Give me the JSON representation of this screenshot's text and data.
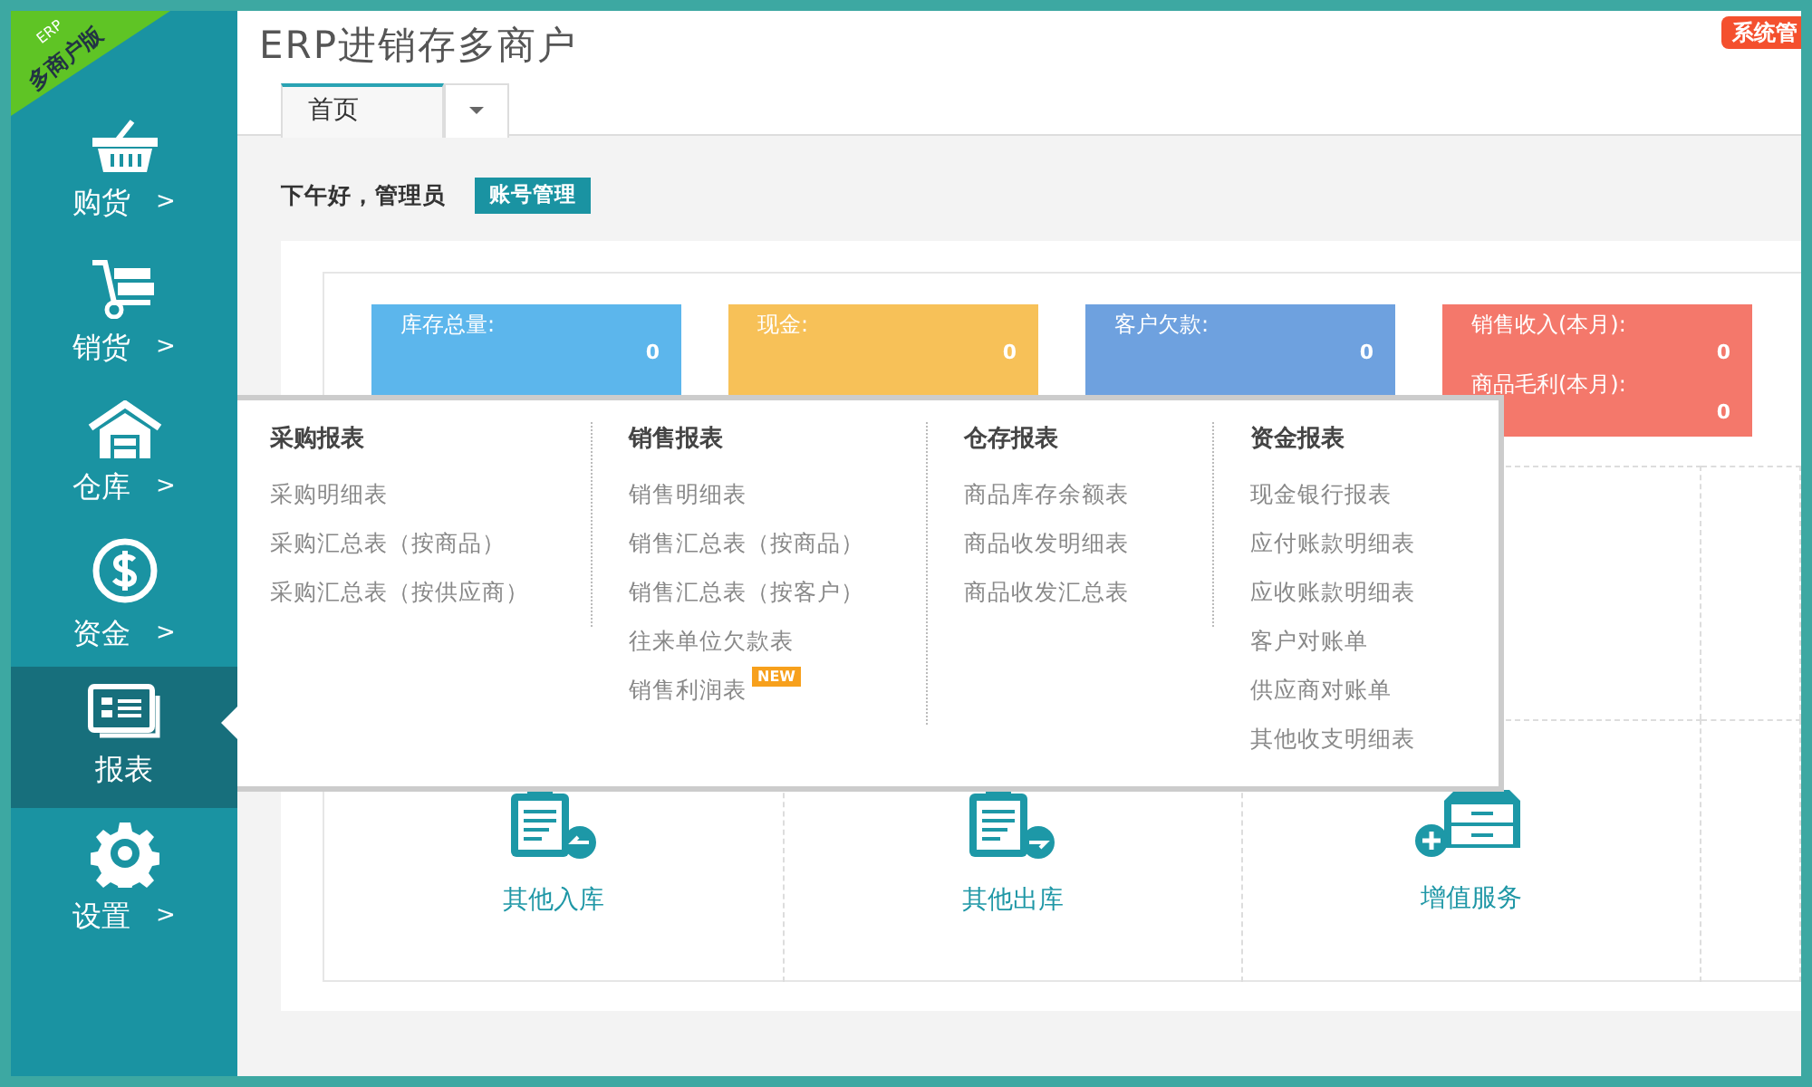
{
  "corner_ribbon": {
    "small": "ERP",
    "large": "多商户版"
  },
  "title": "ERP进销存多商户",
  "admin_button": "系统管",
  "sidebar": [
    {
      "label": "购货",
      "kind": "basket",
      "arrow": ">",
      "selected": false
    },
    {
      "label": "销货",
      "kind": "cart",
      "arrow": ">",
      "selected": false
    },
    {
      "label": "仓库",
      "kind": "house",
      "arrow": ">",
      "selected": false
    },
    {
      "label": "资金",
      "kind": "dollar",
      "arrow": ">",
      "selected": false
    },
    {
      "label": "报表",
      "kind": "report",
      "selected": true
    },
    {
      "label": "设置",
      "kind": "gear",
      "arrow": ">",
      "selected": false
    }
  ],
  "tabs": [
    {
      "label": "首页",
      "selected": true
    }
  ],
  "greeting": "下午好，管理员",
  "account_button": "账号管理",
  "stats": [
    {
      "color": "#5cb6ec",
      "rows": [
        {
          "label": "库存总量:",
          "value": "0"
        }
      ]
    },
    {
      "color": "#f7c158",
      "rows": [
        {
          "label": "现金:",
          "value": "0"
        }
      ]
    },
    {
      "color": "#6ea1df",
      "rows": [
        {
          "label": "客户欠款:",
          "value": "0"
        }
      ]
    },
    {
      "color": "#f4786b",
      "rows": [
        {
          "label": "销售收入(本月):",
          "value": "0"
        },
        {
          "label": "商品毛利(本月):",
          "value": "0"
        }
      ]
    }
  ],
  "quick_links": [
    {
      "label": "其他入库",
      "kind": "clipboard-in"
    },
    {
      "label": "其他出库",
      "kind": "clipboard-out"
    },
    {
      "label": "增值服务",
      "kind": "drawer-plus"
    }
  ],
  "reports_menu": [
    {
      "title": "采购报表",
      "items": [
        {
          "label": "采购明细表"
        },
        {
          "label": "采购汇总表（按商品）"
        },
        {
          "label": "采购汇总表（按供应商）"
        }
      ]
    },
    {
      "title": "销售报表",
      "items": [
        {
          "label": "销售明细表"
        },
        {
          "label": "销售汇总表（按商品）"
        },
        {
          "label": "销售汇总表（按客户）"
        },
        {
          "label": "往来单位欠款表"
        },
        {
          "label": "销售利润表",
          "badge": "NEW"
        }
      ]
    },
    {
      "title": "仓存报表",
      "items": [
        {
          "label": "商品库存余额表"
        },
        {
          "label": "商品收发明细表"
        },
        {
          "label": "商品收发汇总表"
        }
      ]
    },
    {
      "title": "资金报表",
      "items": [
        {
          "label": "现金银行报表"
        },
        {
          "label": "应付账款明细表"
        },
        {
          "label": "应收账款明细表"
        },
        {
          "label": "客户对账单"
        },
        {
          "label": "供应商对账单"
        },
        {
          "label": "其他收支明细表"
        }
      ]
    }
  ]
}
